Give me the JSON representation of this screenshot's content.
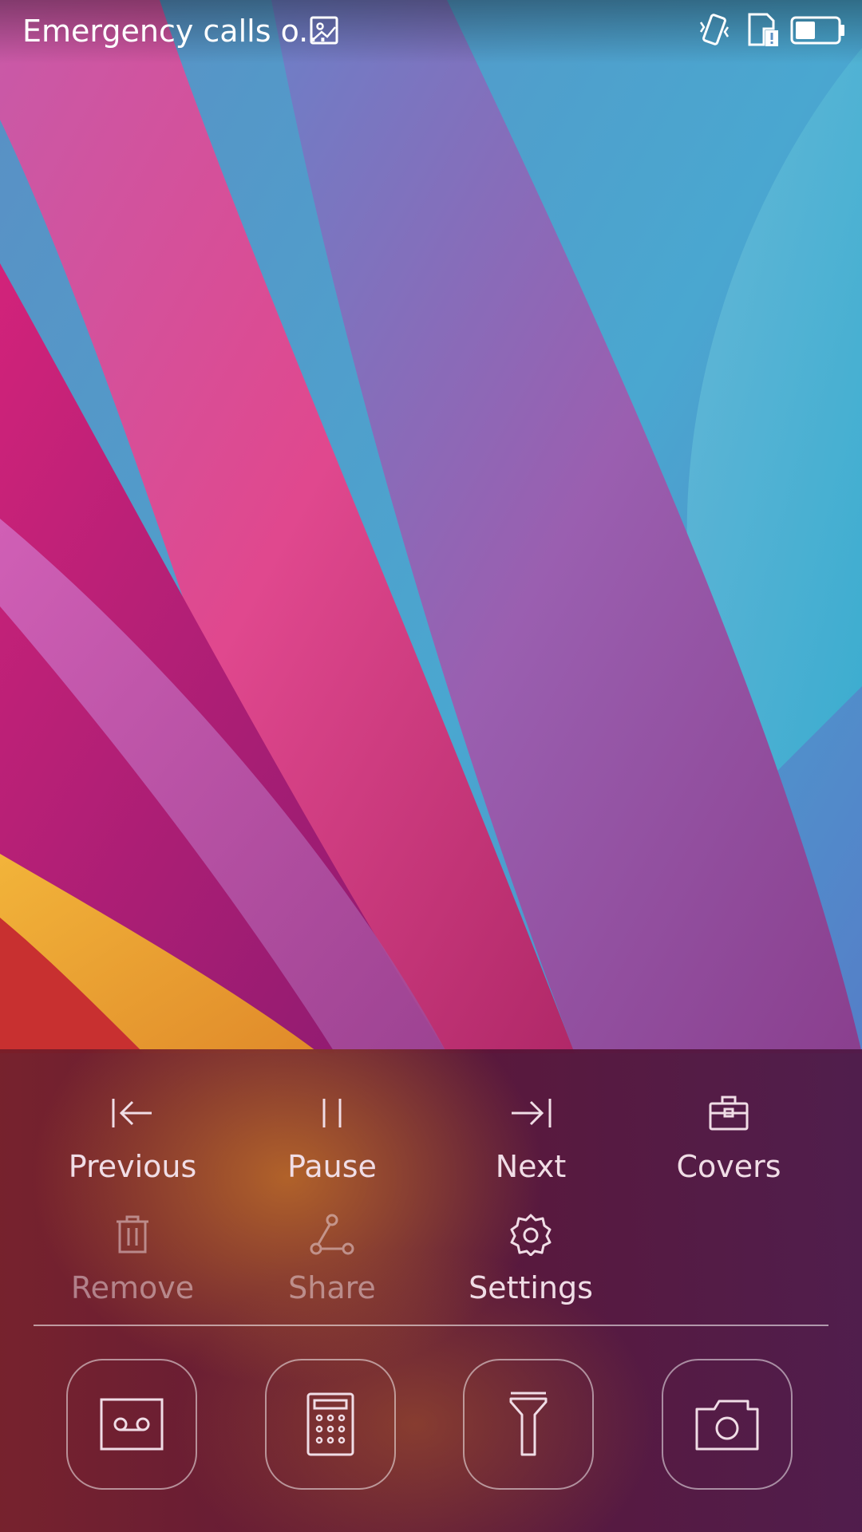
{
  "status_bar": {
    "carrier_text": "Emergency calls o...",
    "icons": [
      "image-notification-icon",
      "vibrate-icon",
      "sim-alert-icon",
      "battery-icon"
    ]
  },
  "panel": {
    "actions": [
      {
        "label": "Previous",
        "icon": "skip-previous-icon",
        "enabled": true
      },
      {
        "label": "Pause",
        "icon": "pause-icon",
        "enabled": true
      },
      {
        "label": "Next",
        "icon": "skip-next-icon",
        "enabled": true
      },
      {
        "label": "Covers",
        "icon": "briefcase-icon",
        "enabled": true
      },
      {
        "label": "Remove",
        "icon": "trash-icon",
        "enabled": false
      },
      {
        "label": "Share",
        "icon": "share-icon",
        "enabled": false
      },
      {
        "label": "Settings",
        "icon": "gear-icon",
        "enabled": true
      }
    ],
    "shortcuts": [
      {
        "icon": "recorder-icon"
      },
      {
        "icon": "calculator-icon"
      },
      {
        "icon": "flashlight-icon"
      },
      {
        "icon": "camera-icon"
      }
    ]
  },
  "colors": {
    "label_text": "#f0dde6",
    "icon_stroke": "#f0dde6"
  }
}
